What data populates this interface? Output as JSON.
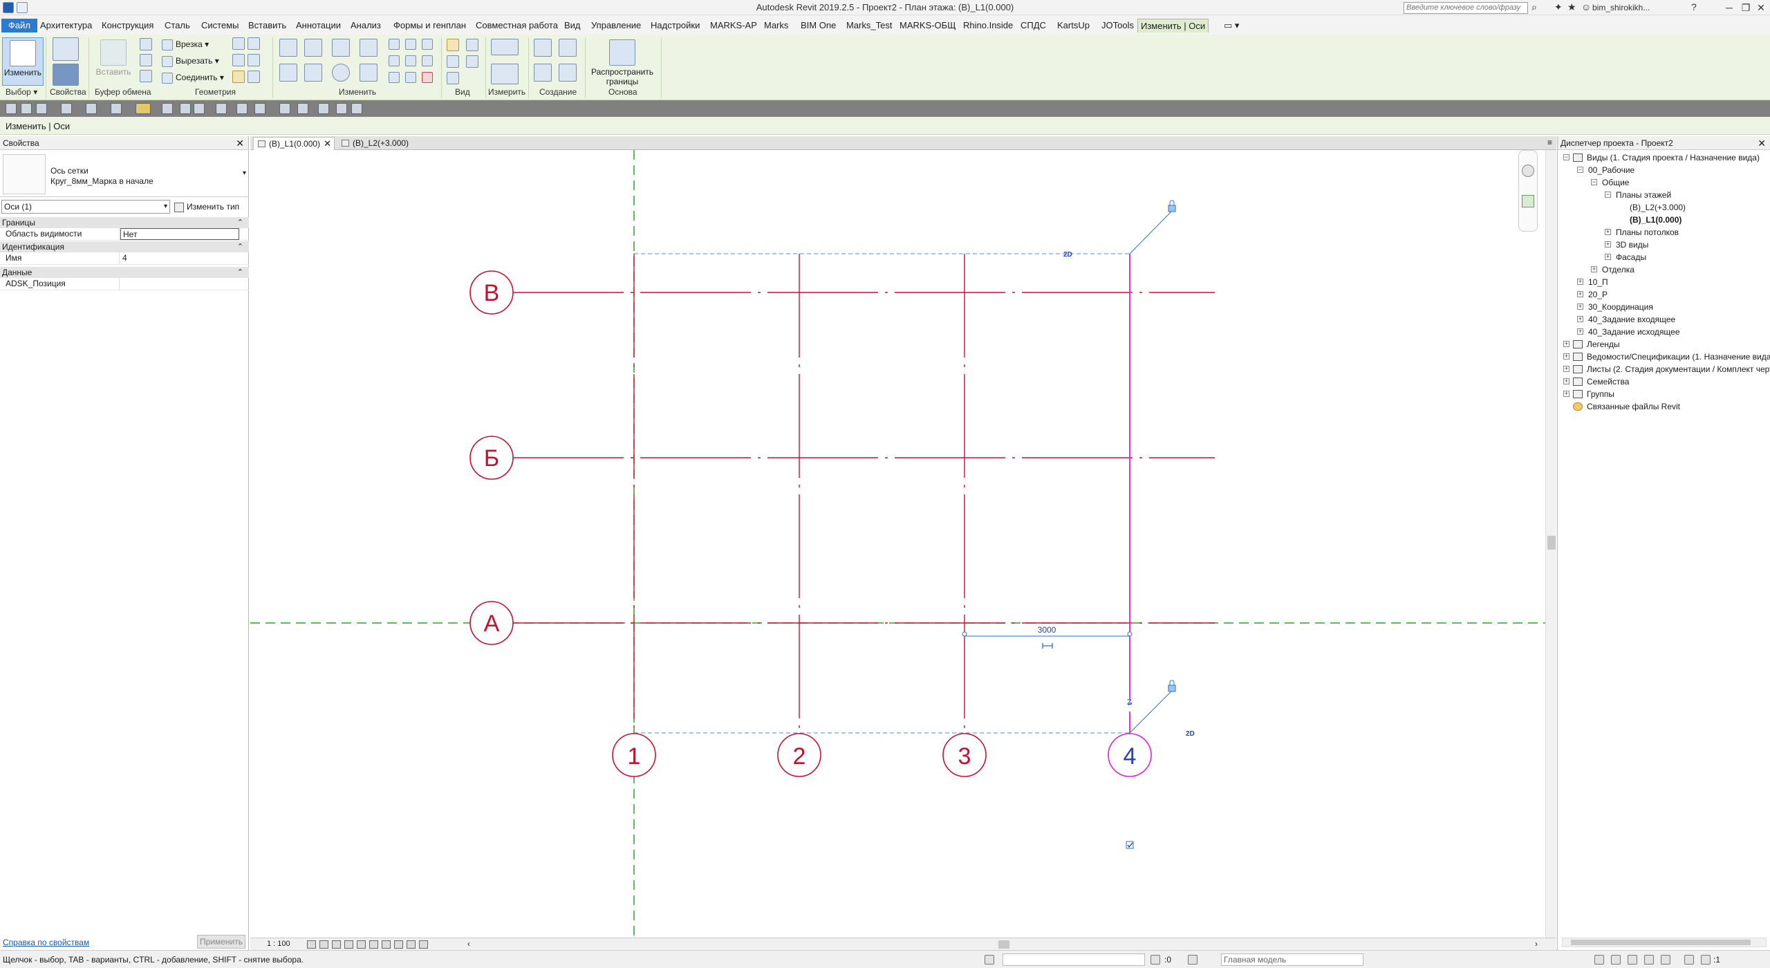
{
  "titlebar": {
    "title": "Autodesk Revit 2019.2.5 - Проект2 - План этажа: (В)_L1(0.000)",
    "search_placeholder": "Введите ключевое слово/фразу",
    "user": "bim_shirokikh...",
    "help": "?",
    "minimize": "─",
    "restore": "❐",
    "close": "✕"
  },
  "menu": {
    "tabs": [
      "Файл",
      "Архитектура",
      "Конструкция",
      "Сталь",
      "Системы",
      "Вставить",
      "Аннотации",
      "Анализ",
      "Формы и генплан",
      "Совместная работа",
      "Вид",
      "Управление",
      "Надстройки",
      "MARKS-AP",
      "Marks",
      "BIM One",
      "Marks_Test",
      "MARKS-ОБЩ",
      "Rhino.Inside",
      "СПДС",
      "KartsUp",
      "JOTools",
      "Изменить | Оси"
    ]
  },
  "ribbon": {
    "modify": "Изменить",
    "paste": "Вставить",
    "cut_join": "Врезка",
    "cut_out": "Вырезать",
    "connect": "Соединить",
    "propagate": "Распространить\nграницы",
    "panels": {
      "select": "Выбор",
      "properties": "Свойства",
      "clipboard": "Буфер обмена",
      "geometry": "Геометрия",
      "modify": "Изменить",
      "view": "Вид",
      "measure": "Измерить",
      "create": "Создание",
      "basis": "Основа"
    }
  },
  "context": {
    "label": "Изменить | Оси"
  },
  "properties": {
    "title": "Свойства",
    "type_family": "Ось сетки",
    "type_name": "Круг_8мм_Марка в начале",
    "instance_filter": "Оси (1)",
    "edit_type": "Изменить тип",
    "groups": {
      "bounds": "Границы",
      "identity": "Идентификация",
      "data": "Данные"
    },
    "rows": {
      "scope_box_label": "Область видимости",
      "scope_box_value": "Нет",
      "name_label": "Имя",
      "name_value": "4",
      "position_label": "ADSK_Позиция",
      "position_value": ""
    },
    "help_link": "Справка по свойствам",
    "apply": "Применить"
  },
  "view_tabs": [
    {
      "label": "(В)_L1(0.000)",
      "active": true
    },
    {
      "label": "(В)_L2(+3.000)",
      "active": false
    }
  ],
  "canvas": {
    "grid_labels_h": [
      "В",
      "Б",
      "А"
    ],
    "grid_labels_v": [
      "1",
      "2",
      "3",
      "4"
    ],
    "dimension": "3000",
    "marker_2d": "2D",
    "grid_color": "#c8102e",
    "selected_color": "#e020e0",
    "dim_color": "#2a6fd6",
    "level_color": "#2ca02c"
  },
  "viewbar": {
    "scale": "1 : 100"
  },
  "browser": {
    "title": "Диспетчер проекта - Проект2",
    "items": [
      {
        "label": "Виды (1. Стадия проекта / Назначение вида)",
        "level": 0,
        "pm": "−",
        "icon": "views-icon"
      },
      {
        "label": "00_Рабочие",
        "level": 1,
        "pm": "−"
      },
      {
        "label": "Общие",
        "level": 2,
        "pm": "−"
      },
      {
        "label": "Планы этажей",
        "level": 3,
        "pm": "−"
      },
      {
        "label": "(В)_L2(+3.000)",
        "level": 4
      },
      {
        "label": "(В)_L1(0.000)",
        "level": 4,
        "bold": true
      },
      {
        "label": "Планы потолков",
        "level": 3,
        "pm": "+"
      },
      {
        "label": "3D виды",
        "level": 3,
        "pm": "+"
      },
      {
        "label": "Фасады",
        "level": 3,
        "pm": "+"
      },
      {
        "label": "Отделка",
        "level": 2,
        "pm": "+"
      },
      {
        "label": "10_П",
        "level": 1,
        "pm": "+"
      },
      {
        "label": "20_Р",
        "level": 1,
        "pm": "+"
      },
      {
        "label": "30_Координация",
        "level": 1,
        "pm": "+"
      },
      {
        "label": "40_Задание входящее",
        "level": 1,
        "pm": "+"
      },
      {
        "label": "40_Задание исходящее",
        "level": 1,
        "pm": "+"
      },
      {
        "label": "Легенды",
        "level": 0,
        "pm": "+",
        "icon": "legend-icon"
      },
      {
        "label": "Ведомости/Спецификации (1. Назначение вида",
        "level": 0,
        "pm": "+",
        "icon": "schedule-icon"
      },
      {
        "label": "Листы (2. Стадия документации / Комплект черт",
        "level": 0,
        "pm": "+",
        "icon": "sheet-icon"
      },
      {
        "label": "Семейства",
        "level": 0,
        "pm": "+",
        "icon": "family-icon"
      },
      {
        "label": "Группы",
        "level": 0,
        "pm": "+",
        "icon": "group-icon"
      },
      {
        "label": "Связанные файлы Revit",
        "level": 0,
        "icon": "link-icon"
      }
    ]
  },
  "status": {
    "message": "Щелчок - выбор, TAB - варианты, CTRL - добавление, SHIFT - снятие выбора.",
    "selection_count": ":0",
    "model": "Главная модель",
    "filter_count": ":1"
  }
}
